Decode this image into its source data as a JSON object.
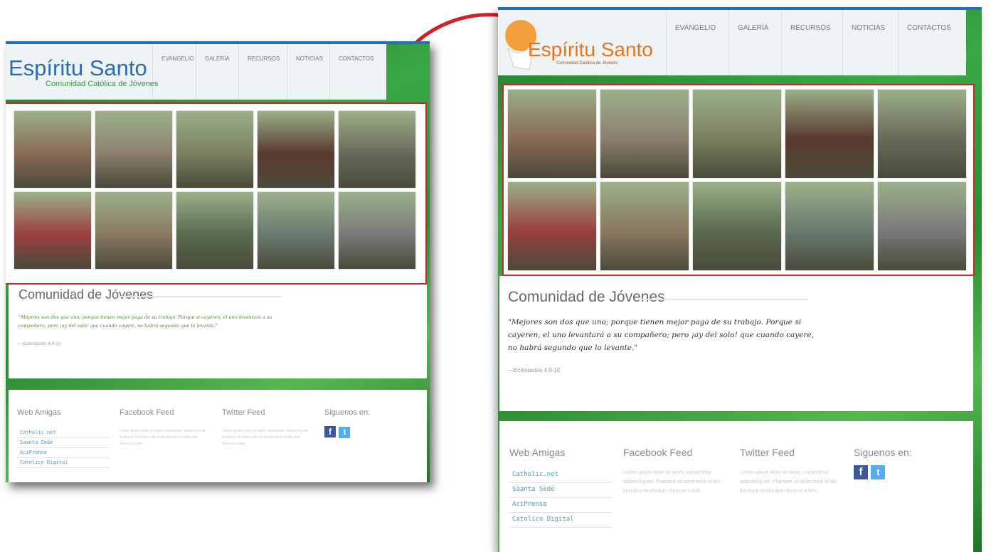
{
  "site": {
    "title": "Espíritu Santo",
    "subtitle": "Comunidad Católica de Jóvenes"
  },
  "nav": {
    "items": [
      "EVANGELIO",
      "GALERÍA",
      "RECURSOS",
      "NOTICIAS",
      "CONTACTOS"
    ]
  },
  "gallery": {
    "photos": [
      {
        "scene": "two-people-smiling-photo",
        "color": "#8a6a55"
      },
      {
        "scene": "people-sitting-on-ground-photo",
        "color": "#8c8070"
      },
      {
        "scene": "group-outdoors-photo",
        "color": "#7b8060"
      },
      {
        "scene": "campfire-group-photo",
        "color": "#5a3a30"
      },
      {
        "scene": "man-by-cross-photo",
        "color": "#6a6a5a"
      },
      {
        "scene": "red-shirt-group-photo",
        "color": "#9a4040"
      },
      {
        "scene": "indoor-group-photo",
        "color": "#8a7a60"
      },
      {
        "scene": "forest-crowd-photo",
        "color": "#5a6a50"
      },
      {
        "scene": "forest-gathering-photo",
        "color": "#6a7a70"
      },
      {
        "scene": "man-raising-arm-photo",
        "color": "#7a7a7a"
      }
    ]
  },
  "community": {
    "heading": "Comunidad de Jóvenes",
    "quote": "\"Mejores son dos que uno; porque tienen mejor paga de su trabajo. Porque si cayeren, el uno levantará a su compañero; pero ¡ay del solo! que cuando cayere, no habrá segundo que lo levante.\"",
    "reference": "—Eclesiastés 4:9-10"
  },
  "footer": {
    "web_amigas_title": "Web Amigas",
    "links": [
      "Catholic.net",
      "Saanta Sede",
      "AciPrensa",
      "Catolico Digital"
    ],
    "facebook_title": "Facebook Feed",
    "facebook_text": "Lorem ipsum dolor sit amet, consectetur adipiscing elit. Praesent sit amet enim id dui tincidunt vestibulum rhoncus a felis.",
    "twitter_title": "Twitter Feed",
    "twitter_text": "Lorem ipsum dolor sit amet, consectetur adipiscing elit. Praesent sit amet enim id dui tincidunt vestibulum rhoncus a felis.",
    "social_title": "Siguenos en:",
    "facebook_glyph": "f",
    "twitter_glyph": "t"
  },
  "colors": {
    "accent_red": "#d42027",
    "site_green": "#2f9a3a",
    "title_blue": "#2a6db5",
    "title_orange": "#e8741e",
    "quote_green": "#4a8a2a"
  }
}
